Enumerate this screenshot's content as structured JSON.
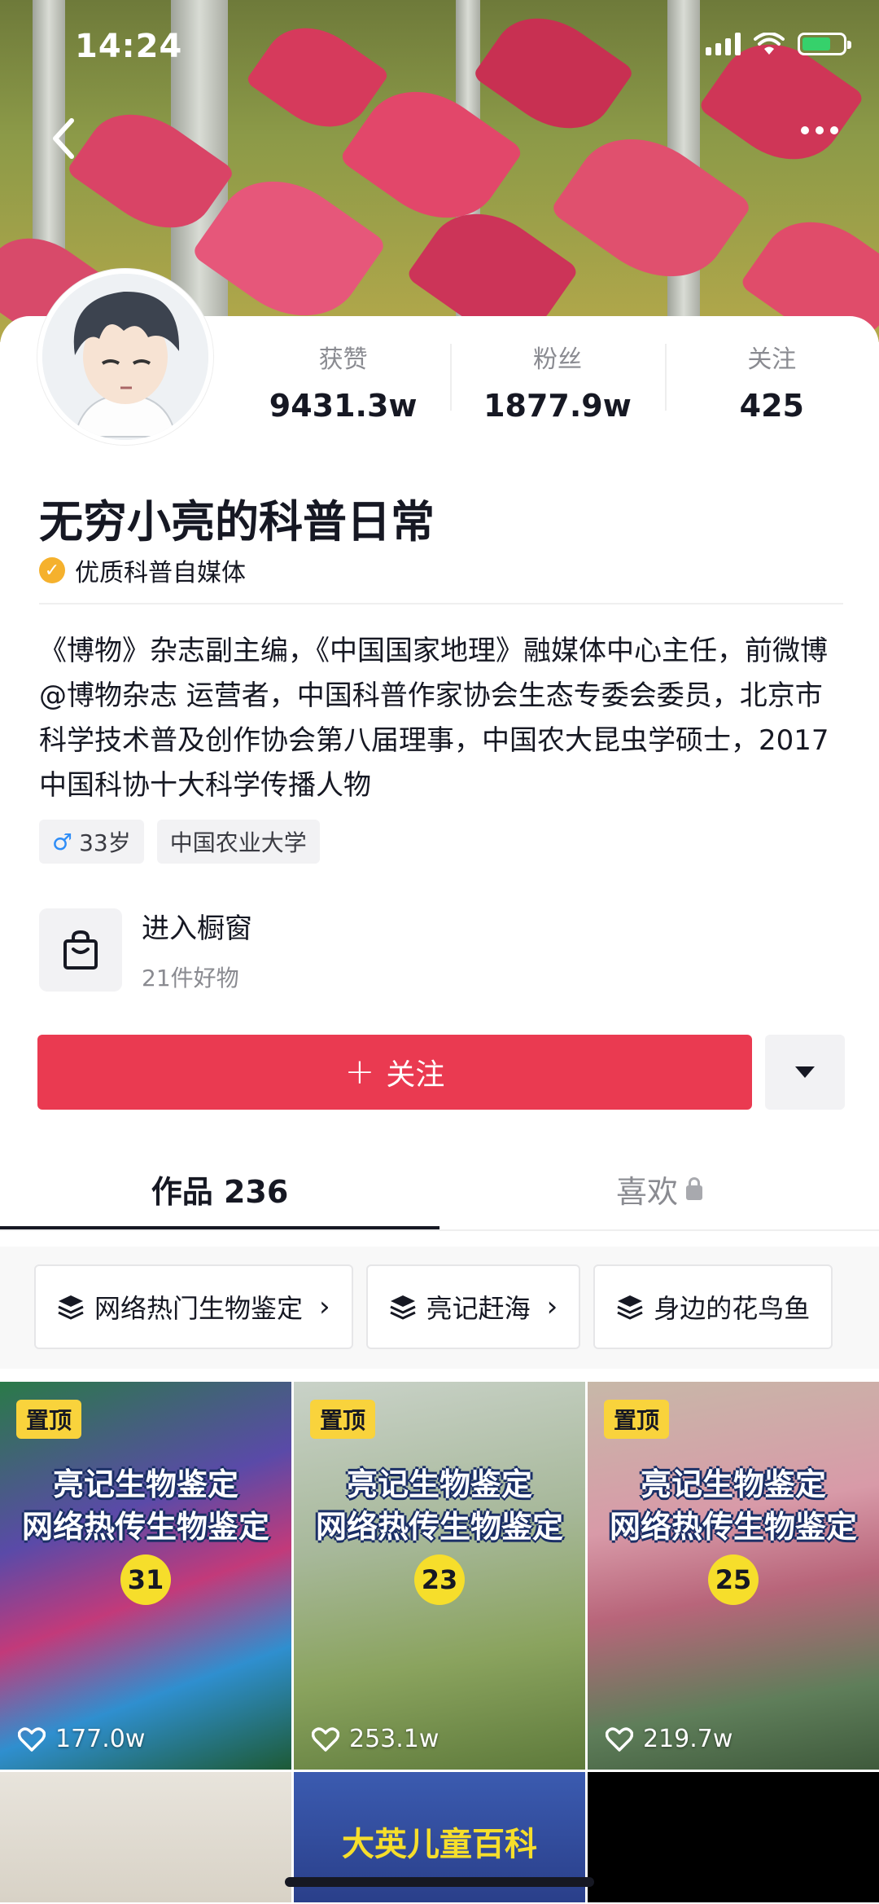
{
  "status_bar": {
    "time": "14:24"
  },
  "profile": {
    "name": "无穷小亮的科普日常",
    "verification": "优质科普自媒体",
    "stats": [
      {
        "label": "获赞",
        "value": "9431.3w"
      },
      {
        "label": "粉丝",
        "value": "1877.9w"
      },
      {
        "label": "关注",
        "value": "425"
      }
    ],
    "bio": "《博物》杂志副主编，《中国国家地理》融媒体中心主任，前微博@博物杂志 运营者，中国科普作家协会生态专委会委员，北京市科学技术普及创作协会第八届理事，中国农大昆虫学硕士，2017中国科协十大科学传播人物",
    "tags": {
      "age": "33岁",
      "school": "中国农业大学"
    }
  },
  "shop": {
    "title": "进入橱窗",
    "subtitle": "21件好物"
  },
  "actions": {
    "follow_label": "关注"
  },
  "tabs": {
    "works": "作品 236",
    "likes": "喜欢"
  },
  "collections": [
    "网络热门生物鉴定",
    "亮记赶海",
    "身边的花鸟鱼"
  ],
  "videos": [
    {
      "pin": "置顶",
      "line1": "亮记生物鉴定",
      "line2": "网络热传生物鉴定",
      "number": "31",
      "likes": "177.0w",
      "bg": "linear-gradient(160deg,#2a7a48 0%,#5a4aa8 35%,#c23a7a 55%,#2f8fcf 75%,#1d5a36 100%)"
    },
    {
      "pin": "置顶",
      "line1": "亮记生物鉴定",
      "line2": "网络热传生物鉴定",
      "number": "23",
      "likes": "253.1w",
      "bg": "linear-gradient(170deg,#c9d2c8 0%,#a7b89a 40%,#8aa35e 70%,#5e7a3b 100%)"
    },
    {
      "pin": "置顶",
      "line1": "亮记生物鉴定",
      "line2": "网络热传生物鉴定",
      "number": "25",
      "likes": "219.7w",
      "bg": "linear-gradient(170deg,#c7b8a8 0%,#d89aa8 35%,#b8657a 55%,#5f7e5a 80%,#3f5a3c 100%)"
    }
  ],
  "videos_row2": [
    {
      "bg": "linear-gradient(180deg,#e8e4dc,#d8d2c6)",
      "text": ""
    },
    {
      "bg": "linear-gradient(180deg,#3b5bb0,#2a3f8a)",
      "text": "大英儿童百科"
    },
    {
      "bg": "#000000",
      "text": ""
    }
  ]
}
